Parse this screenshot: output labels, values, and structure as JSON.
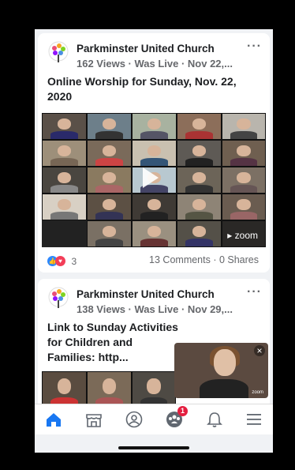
{
  "posts": [
    {
      "page_name": "Parkminster United Church",
      "meta": "162 Views · Was Live · Nov 22,...",
      "title": "Online Worship for Sunday, Nov. 22, 2020",
      "video_overlay": "zoom",
      "reaction_count": "3",
      "comments_shares": "13 Comments · 0 Shares"
    },
    {
      "page_name": "Parkminster United Church",
      "meta": "138 Views · Was Live · Nov 29,...",
      "title": "Link to Sunday Activities for Children and Families: http..."
    }
  ],
  "more_label": "···",
  "pip": {
    "close_label": "×",
    "brand": "zoom"
  },
  "tabbar": {
    "items": [
      {
        "icon": "home-icon",
        "active": true
      },
      {
        "icon": "marketplace-icon"
      },
      {
        "icon": "profile-icon"
      },
      {
        "icon": "groups-icon",
        "badge": "1"
      },
      {
        "icon": "bell-icon"
      },
      {
        "icon": "menu-icon"
      }
    ]
  },
  "colors": {
    "facebook_blue": "#1877f2",
    "badge_red": "#e41e3f",
    "like_blue": "#2d88ff",
    "love_red": "#f33e58"
  }
}
